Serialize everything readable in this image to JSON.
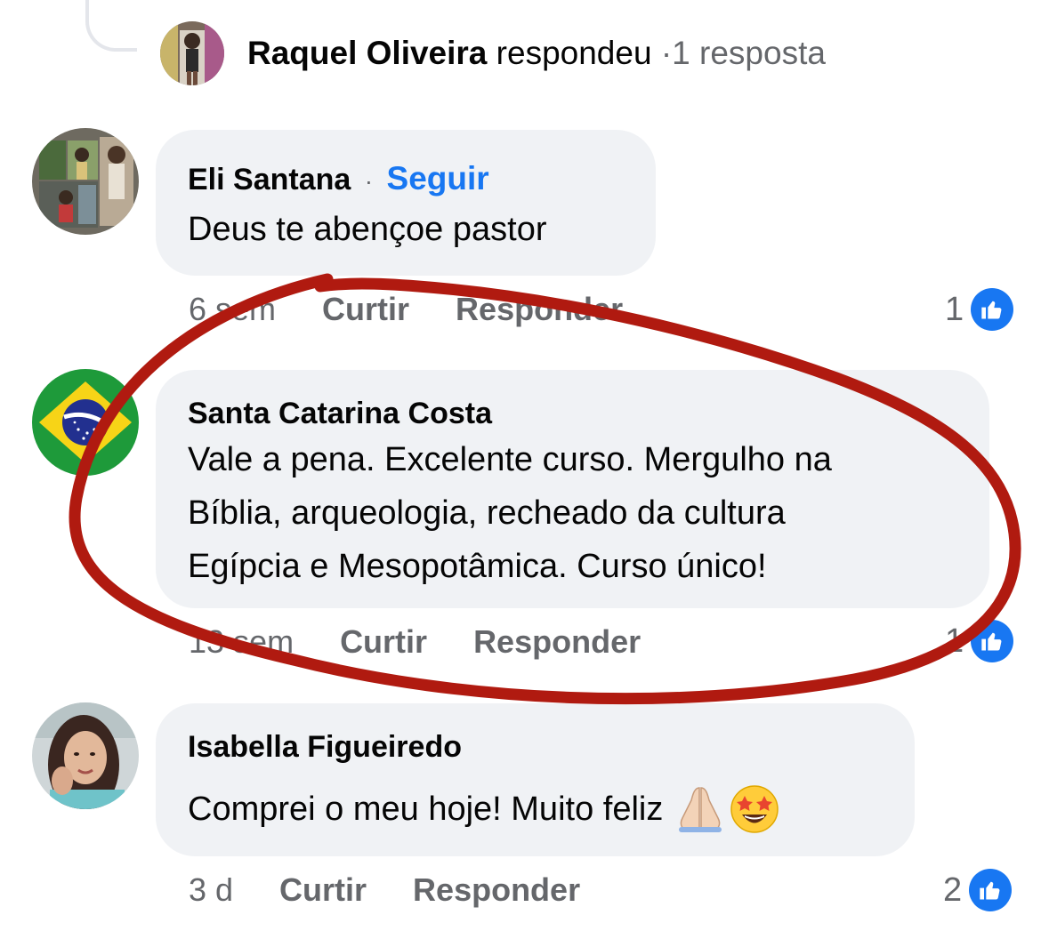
{
  "reply_summary": {
    "name": "Raquel Oliveira",
    "verb": "respondeu",
    "separator": "·",
    "count": "1 resposta"
  },
  "comments": [
    {
      "author": "Eli Santana",
      "follow_separator": "·",
      "follow_label": "Seguir",
      "text": "Deus te abençoe pastor",
      "time": "6 sem",
      "like_label": "Curtir",
      "reply_label": "Responder",
      "reactions": "1"
    },
    {
      "author": "Santa Catarina Costa",
      "text_lines": [
        "Vale a pena. Excelente curso. Mergulho na",
        "Bíblia, arqueologia, recheado da cultura",
        "Egípcia e Mesopotâmica. Curso único!"
      ],
      "time": "13 sem",
      "like_label": "Curtir",
      "reply_label": "Responder",
      "reactions": "1"
    },
    {
      "author": "Isabella Figueiredo",
      "text": "Comprei o meu hoje! Muito feliz",
      "emojis": [
        "folded-hands-emoji",
        "star-struck-emoji"
      ],
      "time": "3 d",
      "like_label": "Curtir",
      "reply_label": "Responder",
      "reactions": "2"
    }
  ],
  "colors": {
    "accent": "#1877f2",
    "bubble": "#f0f2f5",
    "secondary_text": "#65676b",
    "annotation_red": "#b01a10"
  }
}
